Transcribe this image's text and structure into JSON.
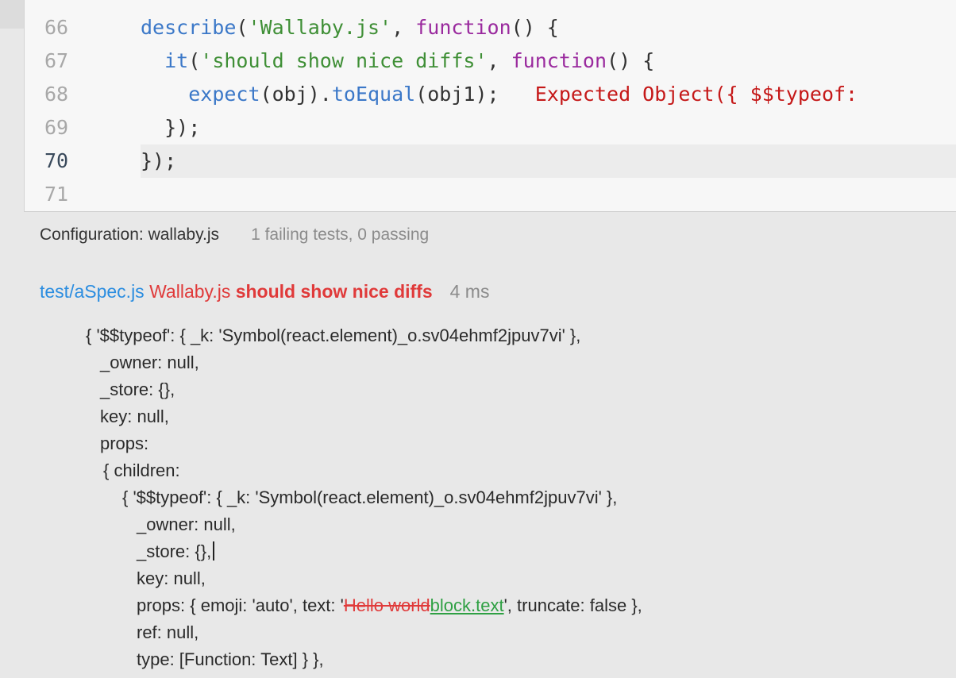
{
  "editor": {
    "lines": [
      {
        "num": "66",
        "status": "pass",
        "tokens": [
          {
            "t": "describe",
            "c": "kw-fn"
          },
          {
            "t": "(",
            "c": "punc"
          },
          {
            "t": "'Wallaby.js'",
            "c": "str"
          },
          {
            "t": ", ",
            "c": "punc"
          },
          {
            "t": "function",
            "c": "kw"
          },
          {
            "t": "() {",
            "c": "punc"
          }
        ]
      },
      {
        "num": "67",
        "status": "pass",
        "tokens": [
          {
            "t": "  ",
            "c": "punc"
          },
          {
            "t": "it",
            "c": "kw-fn"
          },
          {
            "t": "(",
            "c": "punc"
          },
          {
            "t": "'should show nice diffs'",
            "c": "str"
          },
          {
            "t": ", ",
            "c": "punc"
          },
          {
            "t": "function",
            "c": "kw"
          },
          {
            "t": "() {",
            "c": "punc"
          }
        ]
      },
      {
        "num": "68",
        "status": "fail",
        "tokens": [
          {
            "t": "    ",
            "c": "punc"
          },
          {
            "t": "expect",
            "c": "kw-fn"
          },
          {
            "t": "(obj).",
            "c": "punc"
          },
          {
            "t": "toEqual",
            "c": "kw-fn"
          },
          {
            "t": "(obj1);",
            "c": "punc"
          },
          {
            "t": "   Expected Object({ $$typeof:",
            "c": "err"
          }
        ]
      },
      {
        "num": "69",
        "status": "none",
        "tokens": [
          {
            "t": "  });",
            "c": "punc"
          }
        ]
      },
      {
        "num": "70",
        "status": "none",
        "active": true,
        "tokens": [
          {
            "t": "});",
            "c": "punc"
          }
        ]
      },
      {
        "num": "71",
        "status": "none",
        "tokens": []
      }
    ],
    "colors": {
      "pass": "#57a64a",
      "fail": "#f0576f"
    }
  },
  "status": {
    "config": "Configuration: wallaby.js",
    "counts": "1 failing tests, 0 passing"
  },
  "test": {
    "file": "test/aSpec.js",
    "suite": "Wallaby.js",
    "name": "should show nice diffs",
    "time": "4 ms"
  },
  "diff": {
    "line1": "{ '$$typeof': { _k: 'Symbol(react.element)_o.sv04ehmf2jpuv7vi' },",
    "line2": "_owner: null,",
    "line3": "_store: {},",
    "line4": "key: null,",
    "line5": "props:",
    "line6": "{ children:",
    "line7": "{ '$$typeof': { _k: 'Symbol(react.element)_o.sv04ehmf2jpuv7vi' },",
    "line8": "_owner: null,",
    "line9": "_store: {},",
    "line10": "key: null,",
    "line11_before": "props: { emoji: 'auto', text: '",
    "line11_removed": "Hello world",
    "line11_added": "block.text",
    "line11_after": "', truncate: false },",
    "line12": "ref: null,",
    "line13": "type: [Function: Text] } },"
  }
}
